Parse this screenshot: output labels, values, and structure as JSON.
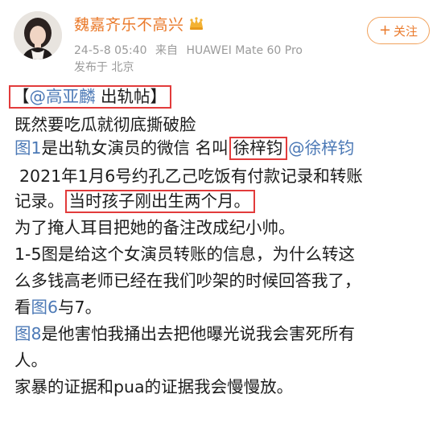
{
  "post": {
    "author": {
      "name": "魏嘉齐乐不高兴",
      "vip_icon": "crown-badge-icon"
    },
    "follow_button": {
      "plus": "+",
      "label": "关注"
    },
    "meta": {
      "date": "24-5-8 05:40",
      "source_prefix": "来自",
      "source": "HUAWEI Mate 60 Pro",
      "location": "发布于 北京"
    },
    "body": {
      "title_open": "【",
      "title_mention": "@高亚麟",
      "title_rest": " 出轨帖】",
      "line2": "既然要吃瓜就彻底撕破脸",
      "line3_link": "图1",
      "line3_text": "是出轨女演员的微信 名叫",
      "line3_boxed": "徐梓钧",
      "line3_mention": "@徐梓钧",
      "line4": "2021年1月6号约孔乙己吃饭有付款记录和转账",
      "line5_text": "记录。",
      "line5_boxed": "当时孩子刚出生两个月。",
      "line6": "为了掩人耳目把她的备注改成纪小帅。",
      "line7": "1-5图是给这个女演员转账的信息，为什么转这",
      "line8": "么多钱高老师已经在我们吵架的时候回答我了，",
      "line9_text1": "看",
      "line9_link": "图6",
      "line9_text2": "与7。",
      "line10_link": "图8",
      "line10_text": "是他害怕我捅出去把他曝光说我会害死所有",
      "line11": "人。",
      "line12": "家暴的证据和pua的证据我会慢慢放。"
    }
  },
  "colors": {
    "username": "#ea7a2b",
    "link": "#4c79b6",
    "meta": "#9a9a9a",
    "highlight_box": "#e23b3b",
    "follow_border": "#f1a25c"
  }
}
